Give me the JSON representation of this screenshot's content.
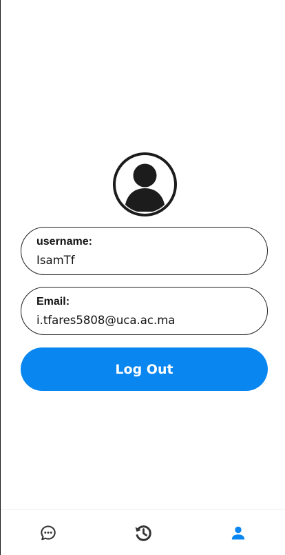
{
  "profile": {
    "avatar_icon": "user-circle-icon",
    "username_label": "username:",
    "username_value": "IsamTf",
    "email_label": "Email:",
    "email_value": "i.tfares5808@uca.ac.ma"
  },
  "actions": {
    "logout_label": "Log Out"
  },
  "bottom_nav": {
    "items": [
      {
        "icon": "chat-bubble-icon",
        "active": false
      },
      {
        "icon": "history-icon",
        "active": false
      },
      {
        "icon": "person-icon",
        "active": true
      }
    ],
    "active_color": "#0a86f0",
    "inactive_color": "#333333"
  },
  "colors": {
    "accent": "#0a86f0",
    "border": "#1c1c1c",
    "text": "#111111"
  }
}
